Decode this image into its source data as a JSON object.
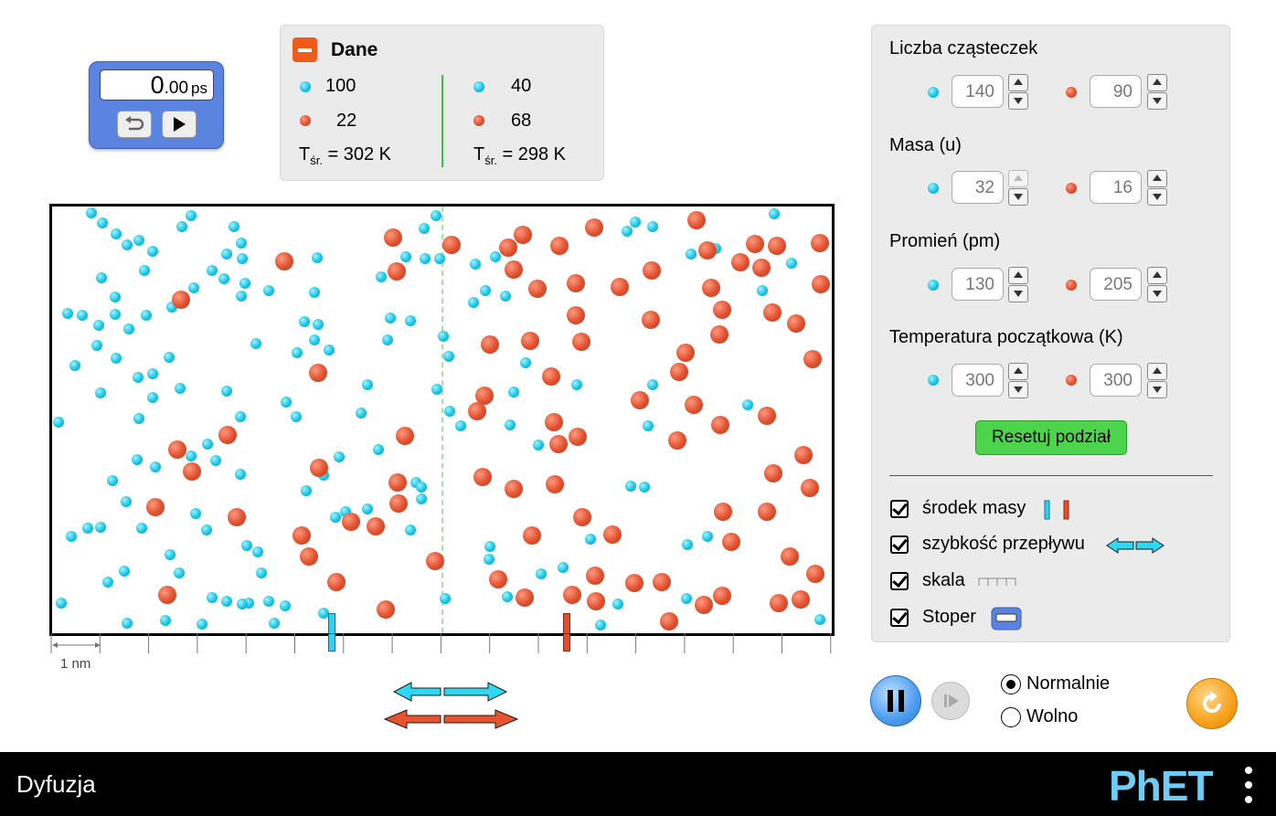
{
  "stopwatch": {
    "value_int": "0",
    "value_dec": ".00",
    "unit": "ps"
  },
  "data_panel": {
    "title": "Dane",
    "left": {
      "cyan_count": "100",
      "red_count": "22",
      "temp_prefix": "T",
      "temp_sub": "śr.",
      "temp_value": " = 302 K"
    },
    "right": {
      "cyan_count": "40",
      "red_count": "68",
      "temp_prefix": "T",
      "temp_sub": "śr.",
      "temp_value": " = 298 K"
    }
  },
  "controls": {
    "particle_count": {
      "title": "Liczba cząsteczek",
      "cyan": "140",
      "red": "90"
    },
    "mass": {
      "title": "Masa (u)",
      "cyan": "32",
      "red": "16"
    },
    "radius": {
      "title": "Promień (pm)",
      "cyan": "130",
      "red": "205"
    },
    "initial_temperature": {
      "title": "Temperatura początkowa (K)",
      "cyan": "300",
      "red": "300"
    },
    "reset_partition_label": "Resetuj podział",
    "checkboxes": {
      "center_of_mass": "środek masy",
      "flow_rate": "szybkość przepływu",
      "scale": "skala",
      "stopwatch": "Stoper"
    }
  },
  "ruler": {
    "label": "1 nm"
  },
  "speed": {
    "normal": "Normalnie",
    "slow": "Wolno",
    "selected": "Normalnie"
  },
  "footer": {
    "title": "Dyfuzja",
    "logo": "PhET"
  },
  "colors": {
    "cyan": "#17c4e3",
    "red": "#e0502e",
    "flow_cyan": "#2fd8f0",
    "flow_red": "#e9522e"
  },
  "particles": {
    "cyan": [
      [
        100,
        233
      ],
      [
        112,
        244
      ],
      [
        127,
        256
      ],
      [
        139,
        268
      ],
      [
        152,
        263
      ],
      [
        167,
        275
      ],
      [
        199,
        248
      ],
      [
        209,
        236
      ],
      [
        256,
        248
      ],
      [
        264,
        266
      ],
      [
        248,
        278
      ],
      [
        265,
        283
      ],
      [
        232,
        296
      ],
      [
        245,
        305
      ],
      [
        268,
        310
      ],
      [
        264,
        324
      ],
      [
        212,
        315
      ],
      [
        188,
        336
      ],
      [
        158,
        296
      ],
      [
        111,
        304
      ],
      [
        126,
        325
      ],
      [
        74,
        343
      ],
      [
        90,
        345
      ],
      [
        108,
        356
      ],
      [
        126,
        344
      ],
      [
        141,
        360
      ],
      [
        160,
        345
      ],
      [
        127,
        392
      ],
      [
        106,
        378
      ],
      [
        82,
        400
      ],
      [
        110,
        430
      ],
      [
        151,
        413
      ],
      [
        167,
        409
      ],
      [
        185,
        391
      ],
      [
        167,
        435
      ],
      [
        197,
        425
      ],
      [
        248,
        428
      ],
      [
        263,
        456
      ],
      [
        152,
        458
      ],
      [
        64,
        462
      ],
      [
        294,
        318
      ],
      [
        344,
        320
      ],
      [
        347,
        282
      ],
      [
        280,
        376
      ],
      [
        333,
        352
      ],
      [
        348,
        355
      ],
      [
        325,
        386
      ],
      [
        344,
        372
      ],
      [
        360,
        383
      ],
      [
        313,
        440
      ],
      [
        324,
        456
      ],
      [
        402,
        421
      ],
      [
        395,
        452
      ],
      [
        427,
        348
      ],
      [
        449,
        351
      ],
      [
        424,
        372
      ],
      [
        417,
        303
      ],
      [
        444,
        281
      ],
      [
        464,
        250
      ],
      [
        477,
        236
      ],
      [
        465,
        283
      ],
      [
        481,
        283
      ],
      [
        485,
        368
      ],
      [
        491,
        390
      ],
      [
        478,
        426
      ],
      [
        492,
        450
      ],
      [
        504,
        466
      ],
      [
        520,
        289
      ],
      [
        542,
        281
      ],
      [
        531,
        318
      ],
      [
        518,
        331
      ],
      [
        553,
        324
      ],
      [
        575,
        397
      ],
      [
        562,
        429
      ],
      [
        558,
        465
      ],
      [
        589,
        487
      ],
      [
        631,
        421
      ],
      [
        695,
        243
      ],
      [
        714,
        248
      ],
      [
        686,
        253
      ],
      [
        756,
        278
      ],
      [
        783,
        272
      ],
      [
        847,
        234
      ],
      [
        866,
        288
      ],
      [
        834,
        318
      ],
      [
        714,
        421
      ],
      [
        709,
        466
      ],
      [
        818,
        443
      ],
      [
        227,
        486
      ],
      [
        209,
        499
      ],
      [
        236,
        504
      ],
      [
        263,
        519
      ],
      [
        150,
        503
      ],
      [
        170,
        511
      ],
      [
        123,
        526
      ],
      [
        138,
        549
      ],
      [
        155,
        578
      ],
      [
        96,
        578
      ],
      [
        78,
        587
      ],
      [
        110,
        577
      ],
      [
        214,
        562
      ],
      [
        226,
        580
      ],
      [
        186,
        607
      ],
      [
        196,
        627
      ],
      [
        136,
        625
      ],
      [
        118,
        637
      ],
      [
        270,
        597
      ],
      [
        282,
        604
      ],
      [
        286,
        627
      ],
      [
        182,
        651
      ],
      [
        232,
        654
      ],
      [
        248,
        658
      ],
      [
        272,
        660
      ],
      [
        294,
        658
      ],
      [
        312,
        663
      ],
      [
        265,
        661
      ],
      [
        221,
        683
      ],
      [
        181,
        679
      ],
      [
        139,
        682
      ],
      [
        300,
        682
      ],
      [
        67,
        660
      ],
      [
        354,
        671
      ],
      [
        354,
        520
      ],
      [
        371,
        500
      ],
      [
        335,
        537
      ],
      [
        367,
        566
      ],
      [
        378,
        560
      ],
      [
        402,
        557
      ],
      [
        414,
        492
      ],
      [
        455,
        528
      ],
      [
        461,
        546
      ],
      [
        449,
        580
      ],
      [
        461,
        533
      ],
      [
        487,
        655
      ],
      [
        536,
        598
      ],
      [
        535,
        612
      ],
      [
        555,
        653
      ],
      [
        592,
        628
      ],
      [
        616,
        621
      ],
      [
        646,
        590
      ],
      [
        676,
        661
      ],
      [
        657,
        684
      ],
      [
        690,
        532
      ],
      [
        705,
        533
      ],
      [
        752,
        596
      ],
      [
        774,
        587
      ],
      [
        751,
        655
      ],
      [
        897,
        678
      ]
    ],
    "red": [
      [
        311,
        286
      ],
      [
        430,
        260
      ],
      [
        434,
        297
      ],
      [
        494,
        268
      ],
      [
        556,
        271
      ],
      [
        572,
        257
      ],
      [
        650,
        249
      ],
      [
        612,
        269
      ],
      [
        562,
        295
      ],
      [
        588,
        316
      ],
      [
        630,
        310
      ],
      [
        678,
        314
      ],
      [
        713,
        296
      ],
      [
        762,
        241
      ],
      [
        774,
        274
      ],
      [
        810,
        287
      ],
      [
        826,
        267
      ],
      [
        850,
        269
      ],
      [
        833,
        293
      ],
      [
        897,
        266
      ],
      [
        898,
        311
      ],
      [
        778,
        315
      ],
      [
        790,
        339
      ],
      [
        845,
        342
      ],
      [
        871,
        354
      ],
      [
        712,
        350
      ],
      [
        630,
        345
      ],
      [
        787,
        366
      ],
      [
        750,
        386
      ],
      [
        743,
        407
      ],
      [
        636,
        374
      ],
      [
        580,
        373
      ],
      [
        536,
        377
      ],
      [
        889,
        393
      ],
      [
        603,
        412
      ],
      [
        700,
        438
      ],
      [
        759,
        443
      ],
      [
        788,
        465
      ],
      [
        839,
        455
      ],
      [
        741,
        482
      ],
      [
        530,
        433
      ],
      [
        522,
        450
      ],
      [
        606,
        462
      ],
      [
        611,
        486
      ],
      [
        632,
        478
      ],
      [
        443,
        477
      ],
      [
        348,
        408
      ],
      [
        198,
        328
      ],
      [
        194,
        492
      ],
      [
        210,
        516
      ],
      [
        249,
        476
      ],
      [
        259,
        566
      ],
      [
        170,
        555
      ],
      [
        349,
        512
      ],
      [
        435,
        528
      ],
      [
        436,
        551
      ],
      [
        384,
        571
      ],
      [
        411,
        576
      ],
      [
        330,
        586
      ],
      [
        338,
        609
      ],
      [
        368,
        637
      ],
      [
        476,
        614
      ],
      [
        422,
        667
      ],
      [
        528,
        522
      ],
      [
        562,
        535
      ],
      [
        607,
        530
      ],
      [
        637,
        566
      ],
      [
        670,
        585
      ],
      [
        582,
        586
      ],
      [
        846,
        518
      ],
      [
        879,
        498
      ],
      [
        886,
        534
      ],
      [
        791,
        560
      ],
      [
        839,
        560
      ],
      [
        800,
        593
      ],
      [
        864,
        609
      ],
      [
        892,
        628
      ],
      [
        545,
        634
      ],
      [
        574,
        654
      ],
      [
        651,
        630
      ],
      [
        626,
        651
      ],
      [
        652,
        658
      ],
      [
        694,
        638
      ],
      [
        724,
        637
      ],
      [
        790,
        652
      ],
      [
        770,
        662
      ],
      [
        852,
        660
      ],
      [
        876,
        656
      ],
      [
        732,
        680
      ],
      [
        183,
        651
      ]
    ]
  }
}
